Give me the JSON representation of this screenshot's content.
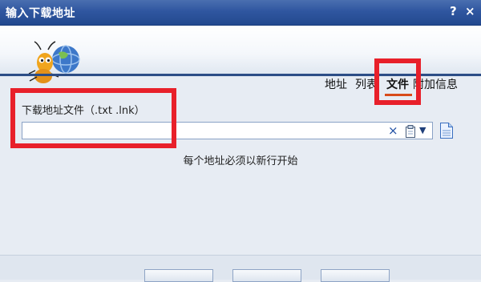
{
  "window": {
    "title": "输入下载地址",
    "help_label": "?",
    "close_label": "×"
  },
  "tabs": [
    {
      "label": "地址",
      "active": false
    },
    {
      "label": "列表",
      "active": false
    },
    {
      "label": "文件",
      "active": true
    },
    {
      "label": "附加信息",
      "active": false
    }
  ],
  "form": {
    "field_label": "下载地址文件（.txt .lnk）",
    "field_value": "",
    "clear_icon": "×",
    "dropdown_icon": "▼",
    "hint": "每个地址必须以新行开始"
  },
  "icons": {
    "logo": "ant-globe-logo-icon",
    "paste": "clipboard-icon",
    "browse": "document-icon"
  },
  "colors": {
    "titlebar": "#2f56a0",
    "highlight": "#e8202a",
    "active_tab_underline": "#d84b1a"
  }
}
